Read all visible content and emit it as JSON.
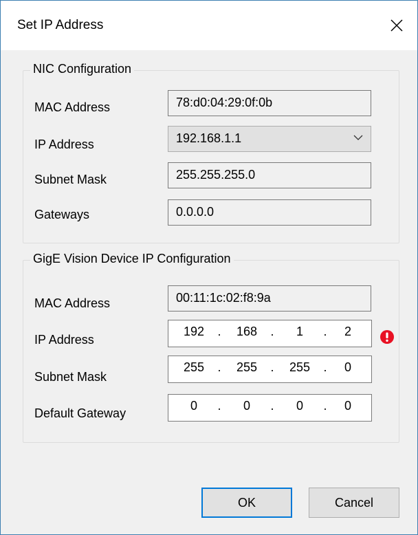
{
  "dialog": {
    "title": "Set IP Address"
  },
  "nic": {
    "legend": "NIC Configuration",
    "mac_label": "MAC Address",
    "mac_value": "78:d0:04:29:0f:0b",
    "ip_label": "IP Address",
    "ip_selected": "192.168.1.1",
    "subnet_label": "Subnet Mask",
    "subnet_value": "255.255.255.0",
    "gateways_label": "Gateways",
    "gateways_value": "0.0.0.0"
  },
  "device": {
    "legend": "GigE Vision Device IP Configuration",
    "mac_label": "MAC Address",
    "mac_value": "00:11:1c:02:f8:9a",
    "ip_label": "IP Address",
    "ip_octets": [
      "192",
      "168",
      "1",
      "2"
    ],
    "subnet_label": "Subnet Mask",
    "subnet_octets": [
      "255",
      "255",
      "255",
      "0"
    ],
    "gateway_label": "Default Gateway",
    "gateway_octets": [
      "0",
      "0",
      "0",
      "0"
    ],
    "error_icon": "exclamation-error-icon",
    "error_color": "#e81123"
  },
  "buttons": {
    "ok": "OK",
    "cancel": "Cancel"
  },
  "colors": {
    "accent": "#0078d7"
  }
}
